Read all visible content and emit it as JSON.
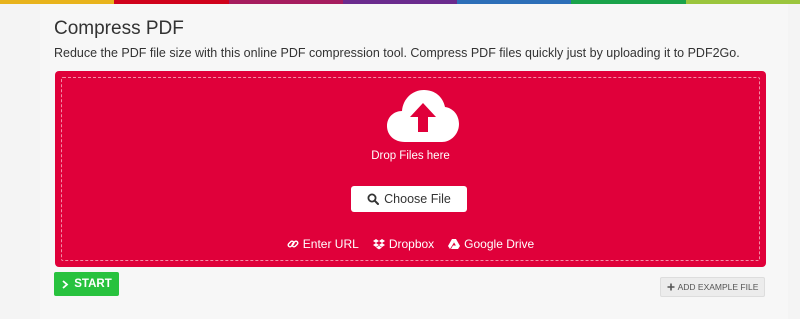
{
  "top_bar_colors": [
    "#e8b31c",
    "#d0021b",
    "#a61d5f",
    "#6b2b8e",
    "#2d6fb8",
    "#1aa34a",
    "#9bc53d"
  ],
  "page": {
    "title": "Compress PDF",
    "subtitle": "Reduce the PDF file size with this online PDF compression tool. Compress PDF files quickly just by uploading it to PDF2Go."
  },
  "dropzone": {
    "accent_color": "#e0003a",
    "upload_icon": "cloud-upload-icon",
    "drop_text": "Drop Files here",
    "choose_file_label": "Choose File",
    "choose_file_icon": "search-icon",
    "sources": [
      {
        "label": "Enter URL",
        "icon": "link-icon"
      },
      {
        "label": "Dropbox",
        "icon": "dropbox-icon"
      },
      {
        "label": "Google Drive",
        "icon": "google-drive-icon"
      }
    ]
  },
  "actions": {
    "start_label": "START",
    "start_color": "#28c23e",
    "add_example_label": "ADD EXAMPLE FILE"
  }
}
